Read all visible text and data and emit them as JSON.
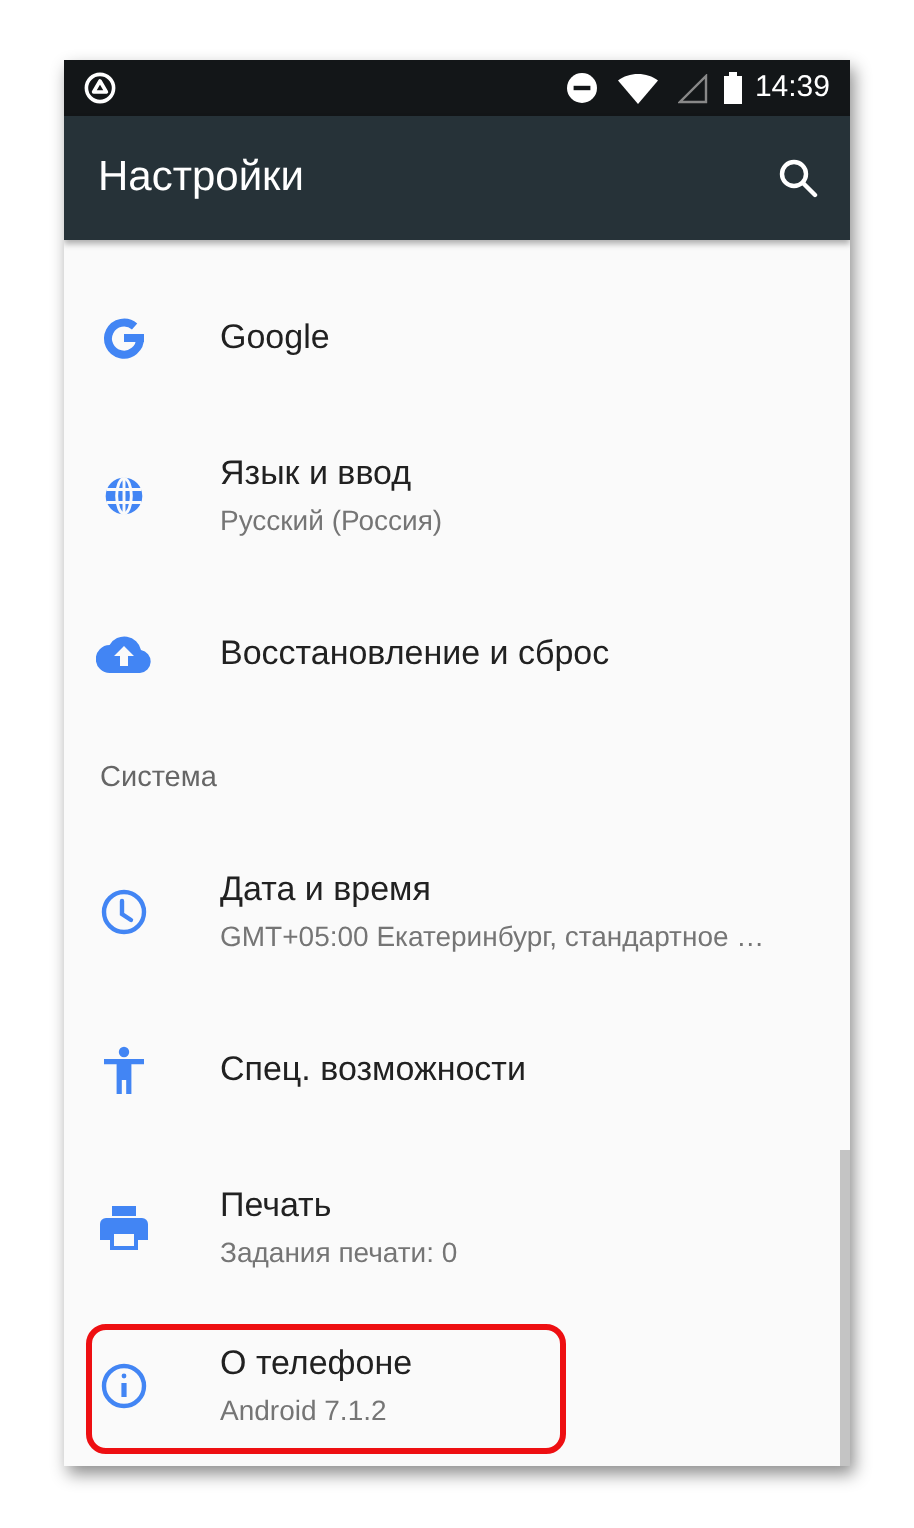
{
  "status_bar": {
    "time": "14:39"
  },
  "toolbar": {
    "title": "Настройки"
  },
  "sections": [
    {
      "items": [
        {
          "title": "Google",
          "highlighted": false
        },
        {
          "title": "Язык и ввод",
          "subtitle": "Русский (Россия)",
          "highlighted": false
        },
        {
          "title": "Восстановление и сброс",
          "highlighted": false
        }
      ]
    },
    {
      "header": "Система",
      "items": [
        {
          "title": "Дата и время",
          "subtitle": "GMT+05:00 Екатеринбург, стандартное …",
          "highlighted": false
        },
        {
          "title": "Спец. возможности",
          "highlighted": false
        },
        {
          "title": "Печать",
          "subtitle": "Задания печати: 0",
          "highlighted": false
        },
        {
          "title": "О телефоне",
          "subtitle": "Android 7.1.2",
          "highlighted": true
        }
      ]
    }
  ]
}
